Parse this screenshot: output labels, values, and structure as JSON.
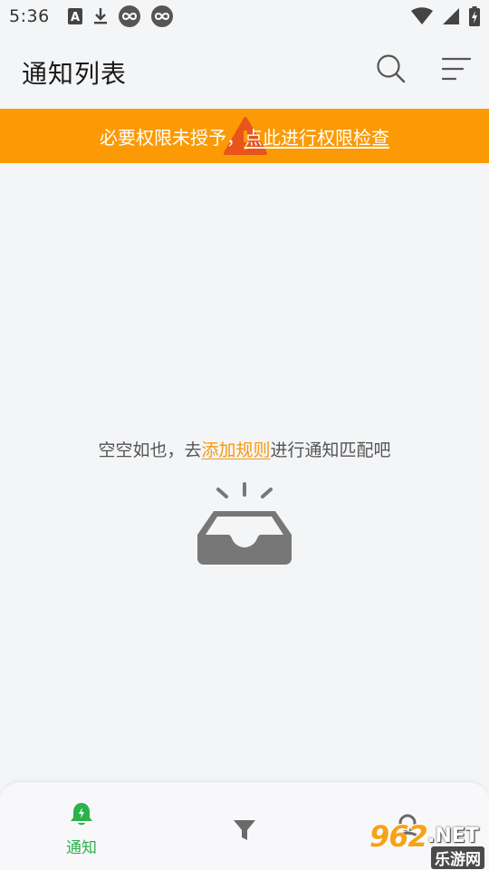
{
  "status_bar": {
    "time": "5:36",
    "left_icons": [
      "font-a-icon",
      "download-icon",
      "infinity-icon",
      "infinity-icon"
    ],
    "right_icons": [
      "wifi-icon",
      "cell-signal-icon",
      "battery-charging-icon"
    ]
  },
  "header": {
    "title": "通知列表",
    "actions": [
      "search-icon",
      "sort-menu-icon"
    ]
  },
  "permission_banner": {
    "prefix": "必要权限未授予，",
    "link": "点此进行权限检查",
    "background": "#fb9a05",
    "icon": "warning-icon"
  },
  "empty_state": {
    "before": "空空如也，去",
    "link": "添加规则",
    "after": "进行通知匹配吧",
    "link_color": "#f59a12",
    "illustration": "empty-inbox-icon"
  },
  "bottom_nav": {
    "active_color": "#2bb24c",
    "items": [
      {
        "label": "通知",
        "icon": "bell-icon",
        "active": true
      },
      {
        "label": "",
        "icon": "filter-icon",
        "active": false
      },
      {
        "label": "",
        "icon": "user-icon",
        "active": false
      }
    ]
  },
  "watermark": {
    "number": "962",
    "net": ".NET",
    "sub": "乐游网"
  }
}
